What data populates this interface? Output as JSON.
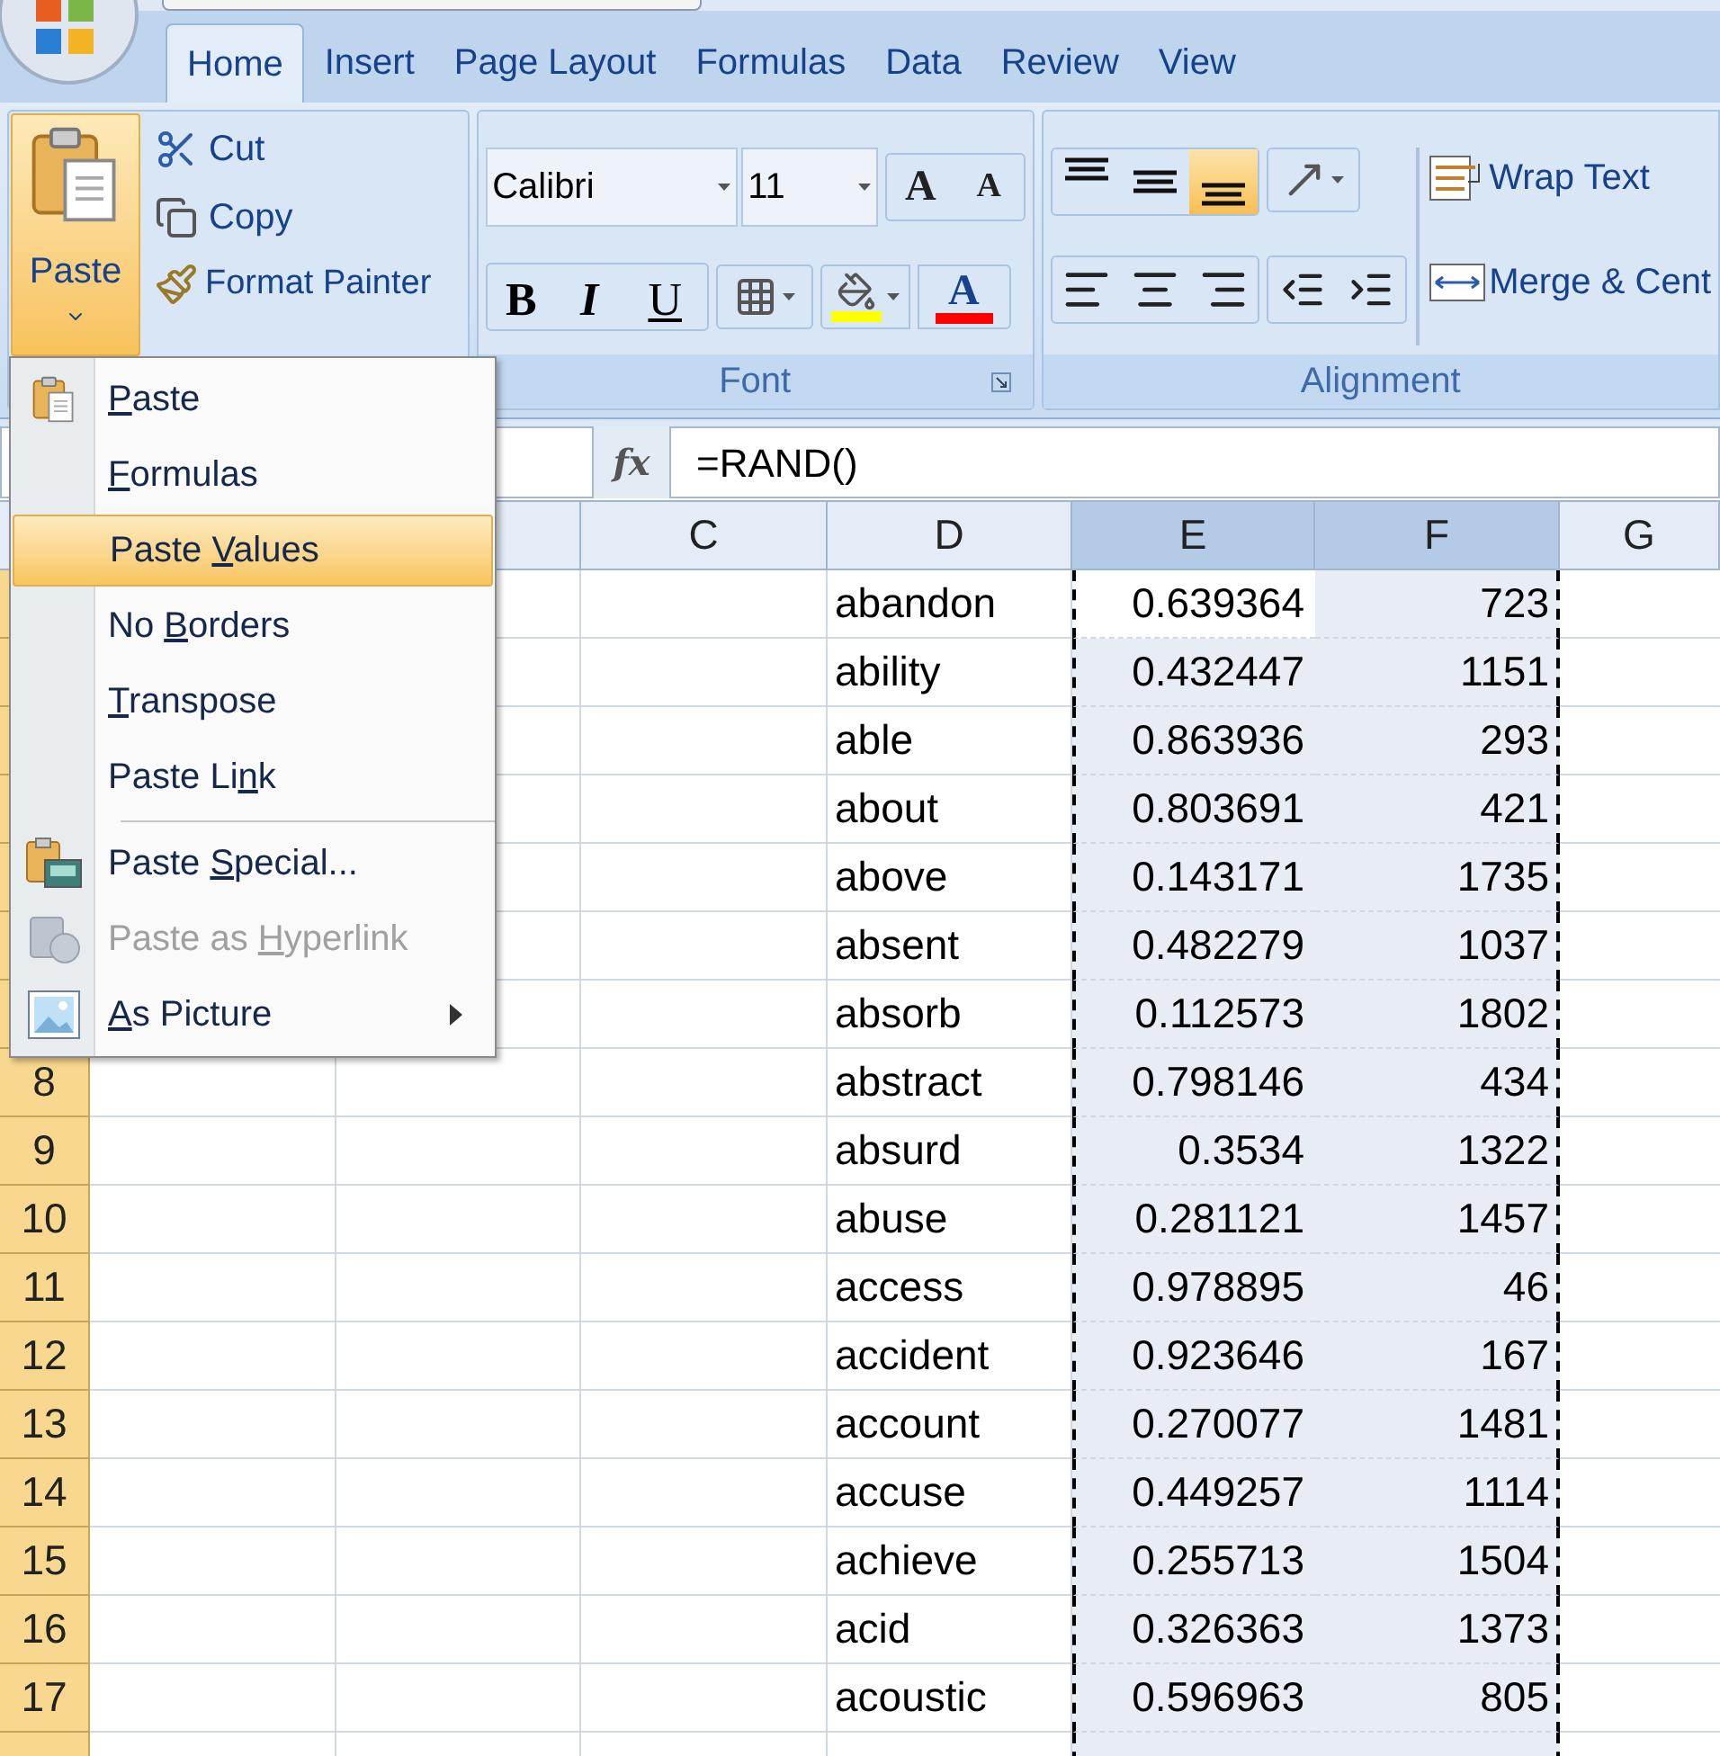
{
  "tabs": [
    {
      "label": "Home",
      "selected": true
    },
    {
      "label": "Insert",
      "selected": false
    },
    {
      "label": "Page Layout",
      "selected": false
    },
    {
      "label": "Formulas",
      "selected": false
    },
    {
      "label": "Data",
      "selected": false
    },
    {
      "label": "Review",
      "selected": false
    },
    {
      "label": "View",
      "selected": false
    }
  ],
  "clipboard": {
    "paste": "Paste",
    "cut": "Cut",
    "copy": "Copy",
    "format_painter": "Format Painter"
  },
  "font": {
    "name": "Calibri",
    "size": "11",
    "grow": "A",
    "shrink": "A",
    "bold": "B",
    "italic": "I",
    "underline": "U",
    "font_color": "A",
    "group_label": "Font"
  },
  "alignment": {
    "vertical": [
      {
        "selected": false
      },
      {
        "selected": false
      },
      {
        "selected": true
      }
    ],
    "wrap_text": "Wrap Text",
    "merge": "Merge & Cent",
    "group_label": "Alignment"
  },
  "formula_bar": {
    "fx": "fx",
    "formula": "=RAND()"
  },
  "columns": [
    {
      "label": "C",
      "selected": false
    },
    {
      "label": "D",
      "selected": false
    },
    {
      "label": "E",
      "selected": true
    },
    {
      "label": "F",
      "selected": true
    },
    {
      "label": "G",
      "selected": false
    }
  ],
  "rows": [
    {
      "d": "abandon",
      "e": "0.639364",
      "f": "723",
      "active": true
    },
    {
      "d": "ability",
      "e": "0.432447",
      "f": "1151",
      "active": false
    },
    {
      "d": "able",
      "e": "0.863936",
      "f": "293",
      "active": false
    },
    {
      "d": "about",
      "e": "0.803691",
      "f": "421",
      "active": false
    },
    {
      "d": "above",
      "e": "0.143171",
      "f": "1735",
      "active": false
    },
    {
      "d": "absent",
      "e": "0.482279",
      "f": "1037",
      "active": false
    },
    {
      "d": "absorb",
      "e": "0.112573",
      "f": "1802",
      "active": false
    },
    {
      "number": "8",
      "d": "abstract",
      "e": "0.798146",
      "f": "434",
      "active": false
    },
    {
      "number": "9",
      "d": "absurd",
      "e": "0.3534",
      "f": "1322",
      "active": false
    },
    {
      "number": "10",
      "d": "abuse",
      "e": "0.281121",
      "f": "1457",
      "active": false
    },
    {
      "number": "11",
      "d": "access",
      "e": "0.978895",
      "f": "46",
      "active": false
    },
    {
      "number": "12",
      "d": "accident",
      "e": "0.923646",
      "f": "167",
      "active": false
    },
    {
      "number": "13",
      "d": "account",
      "e": "0.270077",
      "f": "1481",
      "active": false
    },
    {
      "number": "14",
      "d": "accuse",
      "e": "0.449257",
      "f": "1114",
      "active": false
    },
    {
      "number": "15",
      "d": "achieve",
      "e": "0.255713",
      "f": "1504",
      "active": false
    },
    {
      "number": "16",
      "d": "acid",
      "e": "0.326363",
      "f": "1373",
      "active": false
    },
    {
      "number": "17",
      "d": "acoustic",
      "e": "0.596963",
      "f": "805",
      "active": false
    }
  ],
  "paste_menu": [
    {
      "kind": "item",
      "key": "P",
      "after": "aste",
      "selected": false,
      "disabled": false,
      "submenu": false
    },
    {
      "kind": "item",
      "key": "F",
      "after": "ormulas",
      "selected": false,
      "disabled": false,
      "submenu": false
    },
    {
      "kind": "item",
      "before": "Paste ",
      "key": "V",
      "after": "alues",
      "selected": true,
      "disabled": false,
      "submenu": false
    },
    {
      "kind": "item",
      "before": "No ",
      "key": "B",
      "after": "orders",
      "selected": false,
      "disabled": false,
      "submenu": false
    },
    {
      "kind": "item",
      "key": "T",
      "after": "ranspose",
      "selected": false,
      "disabled": false,
      "submenu": false
    },
    {
      "kind": "item",
      "before": "Paste Li",
      "key": "n",
      "after": "k",
      "selected": false,
      "disabled": false,
      "submenu": false
    },
    {
      "kind": "separator"
    },
    {
      "kind": "item",
      "before": "Paste ",
      "key": "S",
      "after": "pecial...",
      "selected": false,
      "disabled": false,
      "submenu": false
    },
    {
      "kind": "item",
      "before": "Paste as ",
      "key": "H",
      "after": "yperlink",
      "selected": false,
      "disabled": true,
      "submenu": false
    },
    {
      "kind": "item",
      "key": "A",
      "after": "s Picture",
      "selected": false,
      "disabled": false,
      "submenu": true
    }
  ]
}
